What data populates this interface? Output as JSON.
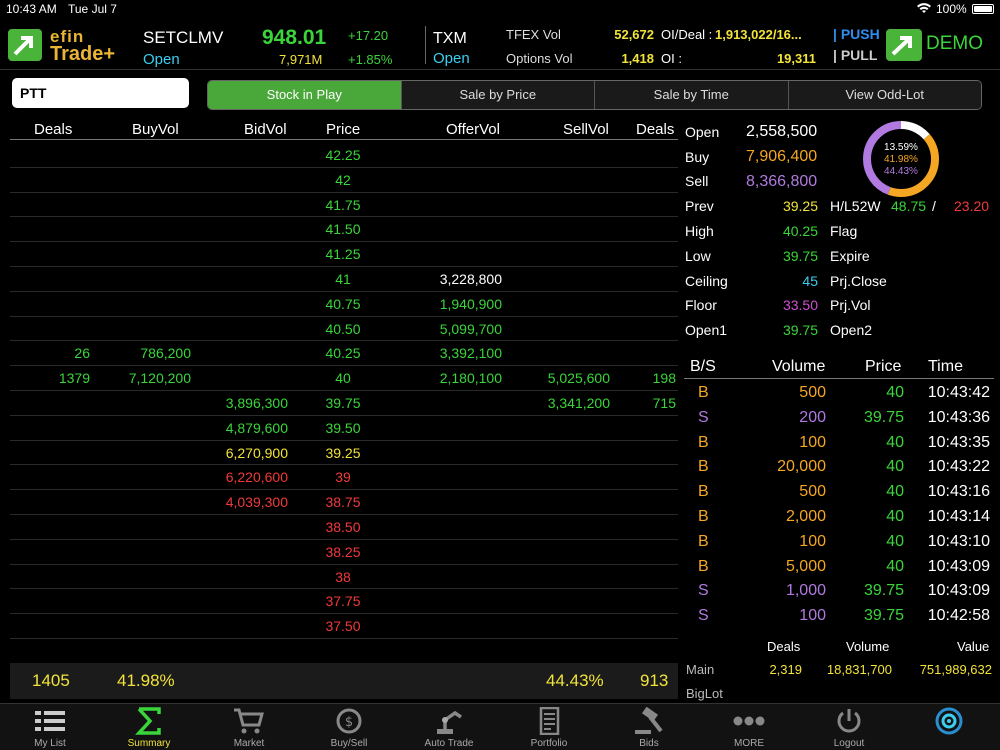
{
  "status_bar": {
    "time": "10:43 AM",
    "date": "Tue Jul 7",
    "battery": "100%"
  },
  "header": {
    "logo_top": "efin",
    "logo_bottom": "Trade+",
    "index_name": "SETCLMV",
    "index_status": "Open",
    "index_value": "948.01",
    "index_volume": "7,971M",
    "index_change": "+17.20",
    "index_change_pct": "+1.85%",
    "txm_name": "TXM",
    "txm_status": "Open",
    "tfex_vol_label": "TFEX Vol",
    "tfex_vol_value": "52,672",
    "options_vol_label": "Options Vol",
    "options_vol_value": "1,418",
    "oi_deal_label": "OI/Deal :",
    "oi_deal_value": "1,913,022/16...",
    "oi_label": "OI :",
    "oi_value": "19,311",
    "push_label": "PUSH",
    "pull_label": "PULL",
    "demo_label": "DEMO"
  },
  "search": {
    "value": "PTT"
  },
  "tabs": [
    {
      "label": "Stock in Play",
      "active": true
    },
    {
      "label": "Sale by Price",
      "active": false
    },
    {
      "label": "Sale by Time",
      "active": false
    },
    {
      "label": "View Odd-Lot",
      "active": false
    }
  ],
  "book": {
    "headers": {
      "deals": "Deals",
      "buyvol": "BuyVol",
      "bidvol": "BidVol",
      "price": "Price",
      "offervol": "OfferVol",
      "sellvol": "SellVol",
      "deals2": "Deals"
    },
    "rows": [
      {
        "bdeals": "",
        "buyvol": "",
        "bidvol": "",
        "price": "42.25",
        "pc": "green",
        "offervol": "",
        "sellvol": "",
        "sdeals": ""
      },
      {
        "bdeals": "",
        "buyvol": "",
        "bidvol": "",
        "price": "42",
        "pc": "green",
        "offervol": "",
        "sellvol": "",
        "sdeals": ""
      },
      {
        "bdeals": "",
        "buyvol": "",
        "bidvol": "",
        "price": "41.75",
        "pc": "green",
        "offervol": "",
        "sellvol": "",
        "sdeals": ""
      },
      {
        "bdeals": "",
        "buyvol": "",
        "bidvol": "",
        "price": "41.50",
        "pc": "green",
        "offervol": "",
        "sellvol": "",
        "sdeals": ""
      },
      {
        "bdeals": "",
        "buyvol": "",
        "bidvol": "",
        "price": "41.25",
        "pc": "green",
        "offervol": "",
        "sellvol": "",
        "sdeals": ""
      },
      {
        "bdeals": "",
        "buyvol": "",
        "bidvol": "",
        "price": "41",
        "pc": "green",
        "offervol": "3,228,800",
        "oc": "white",
        "sellvol": "",
        "sdeals": ""
      },
      {
        "bdeals": "",
        "buyvol": "",
        "bidvol": "",
        "price": "40.75",
        "pc": "green",
        "offervol": "1,940,900",
        "oc": "green",
        "sellvol": "",
        "sdeals": ""
      },
      {
        "bdeals": "",
        "buyvol": "",
        "bidvol": "",
        "price": "40.50",
        "pc": "green",
        "offervol": "5,099,700",
        "oc": "green",
        "sellvol": "",
        "sdeals": ""
      },
      {
        "bdeals": "26",
        "buyvol": "786,200",
        "bidvol": "",
        "price": "40.25",
        "pc": "green",
        "offervol": "3,392,100",
        "oc": "green",
        "sellvol": "",
        "sdeals": ""
      },
      {
        "bdeals": "1379",
        "buyvol": "7,120,200",
        "bidvol": "",
        "price": "40",
        "pc": "green",
        "offervol": "2,180,100",
        "oc": "green",
        "sellvol": "5,025,600",
        "sdeals": "198"
      },
      {
        "bdeals": "",
        "buyvol": "",
        "bidvol": "3,896,300",
        "bc": "green",
        "price": "39.75",
        "pc": "green",
        "offervol": "",
        "sellvol": "3,341,200",
        "sdeals": "715"
      },
      {
        "bdeals": "",
        "buyvol": "",
        "bidvol": "4,879,600",
        "bc": "green",
        "price": "39.50",
        "pc": "green",
        "offervol": "",
        "sellvol": "",
        "sdeals": ""
      },
      {
        "bdeals": "",
        "buyvol": "",
        "bidvol": "6,270,900",
        "bc": "yellow",
        "price": "39.25",
        "pc": "yellow",
        "offervol": "",
        "sellvol": "",
        "sdeals": ""
      },
      {
        "bdeals": "",
        "buyvol": "",
        "bidvol": "6,220,600",
        "bc": "red",
        "price": "39",
        "pc": "red",
        "offervol": "",
        "sellvol": "",
        "sdeals": ""
      },
      {
        "bdeals": "",
        "buyvol": "",
        "bidvol": "4,039,300",
        "bc": "red",
        "price": "38.75",
        "pc": "red",
        "offervol": "",
        "sellvol": "",
        "sdeals": ""
      },
      {
        "bdeals": "",
        "buyvol": "",
        "bidvol": "",
        "price": "38.50",
        "pc": "red",
        "offervol": "",
        "sellvol": "",
        "sdeals": ""
      },
      {
        "bdeals": "",
        "buyvol": "",
        "bidvol": "",
        "price": "38.25",
        "pc": "red",
        "offervol": "",
        "sellvol": "",
        "sdeals": ""
      },
      {
        "bdeals": "",
        "buyvol": "",
        "bidvol": "",
        "price": "38",
        "pc": "red",
        "offervol": "",
        "sellvol": "",
        "sdeals": ""
      },
      {
        "bdeals": "",
        "buyvol": "",
        "bidvol": "",
        "price": "37.75",
        "pc": "red",
        "offervol": "",
        "sellvol": "",
        "sdeals": ""
      },
      {
        "bdeals": "",
        "buyvol": "",
        "bidvol": "",
        "price": "37.50",
        "pc": "red",
        "offervol": "",
        "sellvol": "",
        "sdeals": ""
      }
    ],
    "footer": {
      "buy_deals": "1405",
      "buy_pct": "41.98%",
      "sell_pct": "44.43%",
      "sell_deals": "913"
    }
  },
  "stats": {
    "open_label": "Open",
    "open_value": "2,558,500",
    "buy_label": "Buy",
    "buy_value": "7,906,400",
    "sell_label": "Sell",
    "sell_value": "8,366,800",
    "prev_label": "Prev",
    "prev_value": "39.25",
    "hl52w_label": "H/L52W",
    "hl52w_high": "48.75",
    "hl52w_sep": "/",
    "hl52w_low": "23.20",
    "high_label": "High",
    "high_value": "40.25",
    "flag_label": "Flag",
    "low_label": "Low",
    "low_value": "39.75",
    "expire_label": "Expire",
    "ceiling_label": "Ceiling",
    "ceiling_value": "45",
    "prjclose_label": "Prj.Close",
    "floor_label": "Floor",
    "floor_value": "33.50",
    "prjvol_label": "Prj.Vol",
    "open1_label": "Open1",
    "open1_value": "39.75",
    "open2_label": "Open2",
    "donut": {
      "top_pct": "13.59%",
      "buy_pct": "41.98%",
      "sell_pct": "44.43%",
      "buy_frac": 0.4198,
      "sell_frac": 0.4443,
      "other_frac": 0.1359
    }
  },
  "trades": {
    "headers": {
      "bs": "B/S",
      "volume": "Volume",
      "price": "Price",
      "time": "Time"
    },
    "rows": [
      {
        "side": "B",
        "volume": "500",
        "price": "40",
        "time": "10:43:42"
      },
      {
        "side": "S",
        "volume": "200",
        "price": "39.75",
        "time": "10:43:36"
      },
      {
        "side": "B",
        "volume": "100",
        "price": "40",
        "time": "10:43:35"
      },
      {
        "side": "B",
        "volume": "20,000",
        "price": "40",
        "time": "10:43:22"
      },
      {
        "side": "B",
        "volume": "500",
        "price": "40",
        "time": "10:43:16"
      },
      {
        "side": "B",
        "volume": "2,000",
        "price": "40",
        "time": "10:43:14"
      },
      {
        "side": "B",
        "volume": "100",
        "price": "40",
        "time": "10:43:10"
      },
      {
        "side": "B",
        "volume": "5,000",
        "price": "40",
        "time": "10:43:09"
      },
      {
        "side": "S",
        "volume": "1,000",
        "price": "39.75",
        "time": "10:43:09"
      },
      {
        "side": "S",
        "volume": "100",
        "price": "39.75",
        "time": "10:42:58"
      }
    ]
  },
  "summary": {
    "headers": {
      "deals": "Deals",
      "volume": "Volume",
      "value": "Value"
    },
    "main_label": "Main",
    "main_deals": "2,319",
    "main_volume": "18,831,700",
    "main_value": "751,989,632",
    "biglot_label": "BigLot"
  },
  "tabbar": [
    {
      "label": "My List",
      "icon": "list-icon"
    },
    {
      "label": "Summary",
      "icon": "sigma-icon",
      "active": true
    },
    {
      "label": "Market",
      "icon": "cart-icon"
    },
    {
      "label": "Buy/Sell",
      "icon": "exchange-icon"
    },
    {
      "label": "Auto Trade",
      "icon": "robot-arm-icon"
    },
    {
      "label": "Portfolio",
      "icon": "document-icon"
    },
    {
      "label": "Bids",
      "icon": "gavel-icon"
    },
    {
      "label": "MORE",
      "icon": "more-icon"
    },
    {
      "label": "Logout",
      "icon": "power-icon"
    },
    {
      "label": "",
      "icon": "refresh-icon"
    }
  ]
}
